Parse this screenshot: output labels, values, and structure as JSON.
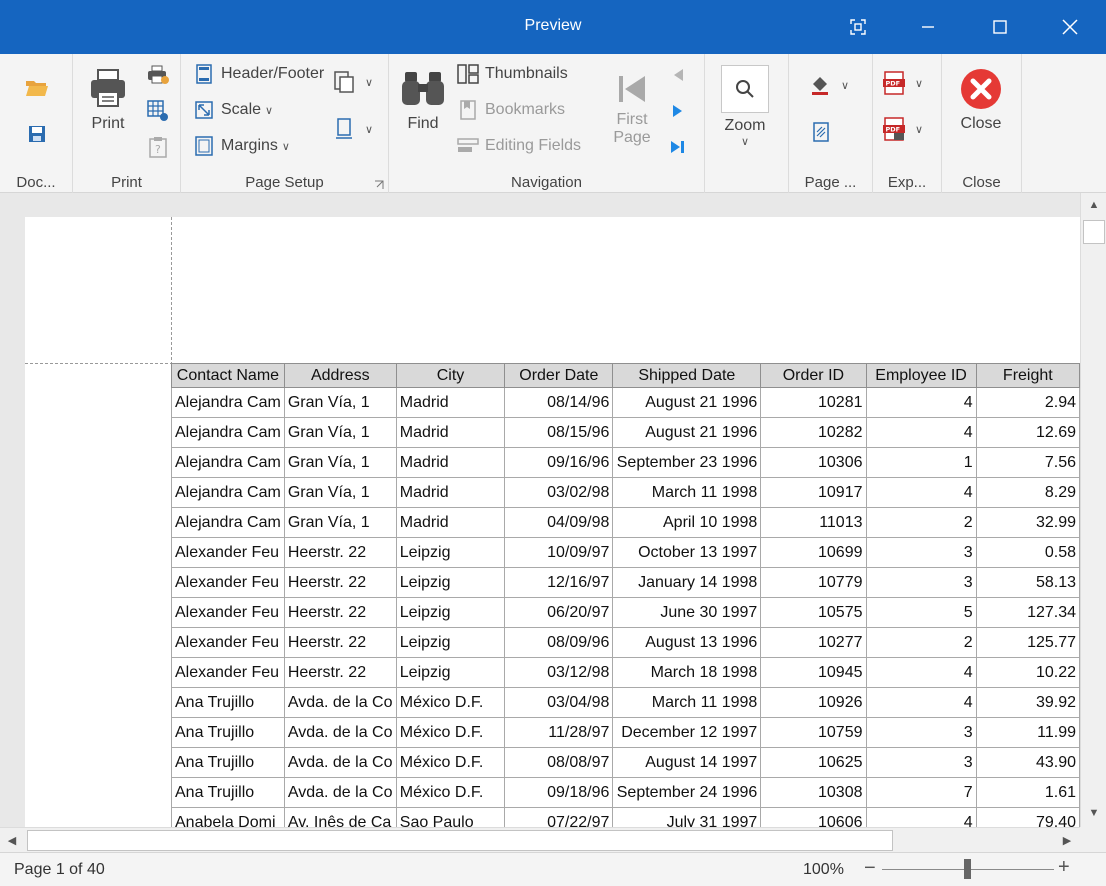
{
  "window": {
    "title": "Preview"
  },
  "ribbon": {
    "document": {
      "label": "Doc..."
    },
    "print": {
      "label": "Print",
      "print_button": "Print"
    },
    "page_setup": {
      "label": "Page Setup",
      "header_footer": "Header/Footer",
      "scale": "Scale",
      "margins": "Margins"
    },
    "navigation": {
      "label": "Navigation",
      "find": "Find",
      "thumbnails": "Thumbnails",
      "bookmarks": "Bookmarks",
      "editing_fields": "Editing Fields",
      "first_page_line1": "First",
      "first_page_line2": "Page"
    },
    "zoom": {
      "label": "Zoom"
    },
    "page_background": {
      "label": "Page ..."
    },
    "export": {
      "label": "Exp..."
    },
    "close": {
      "label": "Close",
      "close_button": "Close"
    }
  },
  "table": {
    "columns": [
      "Contact Name",
      "Address",
      "City",
      "Order Date",
      "Shipped Date",
      "Order ID",
      "Employee ID",
      "Freight"
    ],
    "rows": [
      [
        "Alejandra Cam",
        "Gran Vía, 1",
        "Madrid",
        "08/14/96",
        "August 21 1996",
        "10281",
        "4",
        "2.94"
      ],
      [
        "Alejandra Cam",
        "Gran Vía, 1",
        "Madrid",
        "08/15/96",
        "August 21 1996",
        "10282",
        "4",
        "12.69"
      ],
      [
        "Alejandra Cam",
        "Gran Vía, 1",
        "Madrid",
        "09/16/96",
        "September 23 1996",
        "10306",
        "1",
        "7.56"
      ],
      [
        "Alejandra Cam",
        "Gran Vía, 1",
        "Madrid",
        "03/02/98",
        "March 11 1998",
        "10917",
        "4",
        "8.29"
      ],
      [
        "Alejandra Cam",
        "Gran Vía, 1",
        "Madrid",
        "04/09/98",
        "April 10 1998",
        "11013",
        "2",
        "32.99"
      ],
      [
        "Alexander Feu",
        "Heerstr. 22",
        "Leipzig",
        "10/09/97",
        "October 13 1997",
        "10699",
        "3",
        "0.58"
      ],
      [
        "Alexander Feu",
        "Heerstr. 22",
        "Leipzig",
        "12/16/97",
        "January 14 1998",
        "10779",
        "3",
        "58.13"
      ],
      [
        "Alexander Feu",
        "Heerstr. 22",
        "Leipzig",
        "06/20/97",
        "June 30 1997",
        "10575",
        "5",
        "127.34"
      ],
      [
        "Alexander Feu",
        "Heerstr. 22",
        "Leipzig",
        "08/09/96",
        "August 13 1996",
        "10277",
        "2",
        "125.77"
      ],
      [
        "Alexander Feu",
        "Heerstr. 22",
        "Leipzig",
        "03/12/98",
        "March 18 1998",
        "10945",
        "4",
        "10.22"
      ],
      [
        "Ana Trujillo",
        "Avda. de la Co",
        "México D.F.",
        "03/04/98",
        "March 11 1998",
        "10926",
        "4",
        "39.92"
      ],
      [
        "Ana Trujillo",
        "Avda. de la Co",
        "México D.F.",
        "11/28/97",
        "December 12 1997",
        "10759",
        "3",
        "11.99"
      ],
      [
        "Ana Trujillo",
        "Avda. de la Co",
        "México D.F.",
        "08/08/97",
        "August 14 1997",
        "10625",
        "3",
        "43.90"
      ],
      [
        "Ana Trujillo",
        "Avda. de la Co",
        "México D.F.",
        "09/18/96",
        "September 24 1996",
        "10308",
        "7",
        "1.61"
      ],
      [
        "Anabela Domi",
        "Av. Inês de Ca",
        "Sao Paulo",
        "07/22/97",
        "July 31 1997",
        "10606",
        "4",
        "79.40"
      ]
    ]
  },
  "status": {
    "page_info": "Page 1 of 40",
    "zoom_value": "100%"
  }
}
